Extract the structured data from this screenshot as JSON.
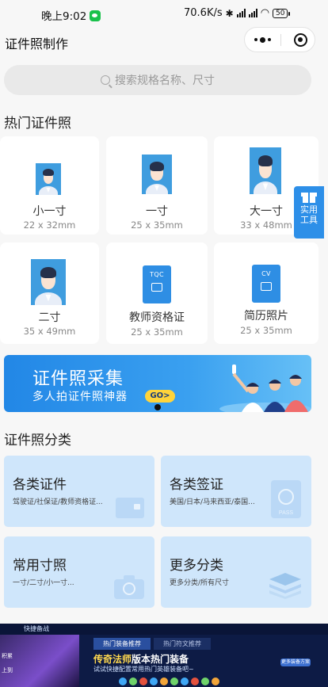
{
  "status_bar": {
    "time": "晚上9:02",
    "network_speed": "70.6K/s",
    "battery": "50"
  },
  "header": {
    "title": "证件照制作"
  },
  "search": {
    "placeholder": "搜索规格名称、尺寸"
  },
  "hot_section": {
    "title": "热门证件照",
    "items": [
      {
        "name": "小一寸",
        "size": "22 x 32mm",
        "icon": "portrait-photo-icon"
      },
      {
        "name": "一寸",
        "size": "25 x 35mm",
        "icon": "portrait-photo-icon"
      },
      {
        "name": "大一寸",
        "size": "33 x 48mm",
        "icon": "portrait-photo-icon"
      },
      {
        "name": "二寸",
        "size": "35 x 49mm",
        "icon": "portrait-photo-icon"
      },
      {
        "name": "教师资格证",
        "size": "25 x 35mm",
        "icon": "tqc-document-icon",
        "badge": "TQC"
      },
      {
        "name": "简历照片",
        "size": "25 x 35mm",
        "icon": "cv-document-icon",
        "badge": "CV"
      }
    ]
  },
  "tool_button": {
    "label_line1": "实用",
    "label_line2": "工具",
    "icon": "gift-icon"
  },
  "banner": {
    "title": "证件照采集",
    "subtitle": "多人拍证件照神器",
    "cta": "GO>"
  },
  "category_section": {
    "title": "证件照分类",
    "items": [
      {
        "name": "各类证件",
        "sub": "驾驶证/社保证/教师资格证...",
        "icon": "id-card-icon"
      },
      {
        "name": "各类签证",
        "sub": "美国/日本/马来西亚/泰国...",
        "icon": "passport-icon"
      },
      {
        "name": "常用寸照",
        "sub": "一寸/二寸/小一寸...",
        "icon": "camera-icon"
      },
      {
        "name": "更多分类",
        "sub": "更多分类/所有尺寸",
        "icon": "layers-icon"
      }
    ]
  },
  "ad": {
    "header": "快捷备战",
    "tab_active": "热门装备推荐",
    "tab_inactive": "热门符文推荐",
    "headline_highlight": "传奇法师",
    "headline_rest": "版本热门装备",
    "sub": "试试快捷配置常用热门英雄装备吧~",
    "side_label_1": "积累",
    "side_label_2": "上到",
    "button": "更多装备方案"
  },
  "colors": {
    "accent": "#2d8fe8",
    "photo_bg": "#3f9ddf",
    "category_bg": "#cfe6fb",
    "go_button": "#ffd43b"
  }
}
